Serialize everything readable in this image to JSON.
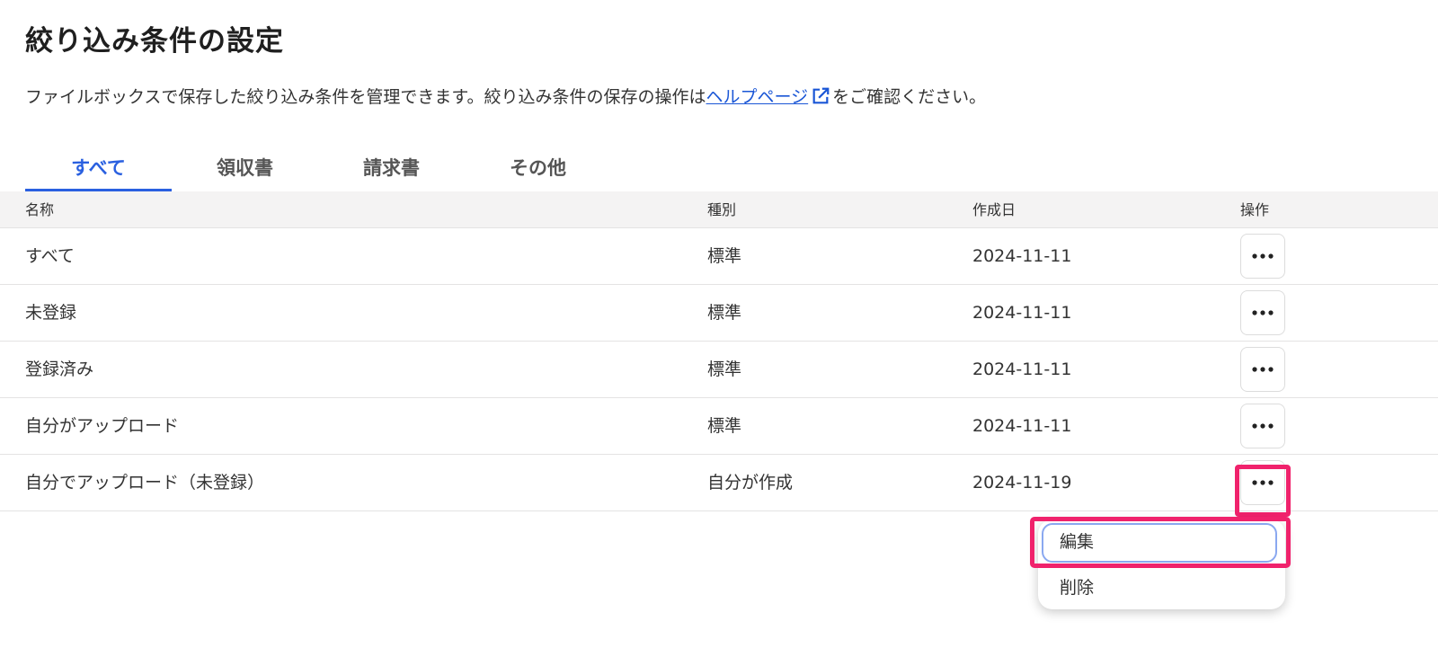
{
  "page": {
    "title": "絞り込み条件の設定",
    "description_before": "ファイルボックスで保存した絞り込み条件を管理できます。絞り込み条件の保存の操作は",
    "help_link": "ヘルプページ",
    "description_after": "をご確認ください。"
  },
  "tabs": [
    {
      "label": "すべて",
      "active": true
    },
    {
      "label": "領収書",
      "active": false
    },
    {
      "label": "請求書",
      "active": false
    },
    {
      "label": "その他",
      "active": false
    }
  ],
  "table": {
    "headers": {
      "name": "名称",
      "type": "種別",
      "created": "作成日",
      "actions": "操作"
    },
    "rows": [
      {
        "name": "すべて",
        "type": "標準",
        "created": "2024-11-11"
      },
      {
        "name": "未登録",
        "type": "標準",
        "created": "2024-11-11"
      },
      {
        "name": "登録済み",
        "type": "標準",
        "created": "2024-11-11"
      },
      {
        "name": "自分がアップロード",
        "type": "標準",
        "created": "2024-11-11"
      },
      {
        "name": "自分でアップロード（未登録）",
        "type": "自分が作成",
        "created": "2024-11-19"
      }
    ]
  },
  "menu": {
    "edit": "編集",
    "delete": "削除"
  },
  "icons": {
    "more": "more-horizontal-icon",
    "external": "external-link-icon"
  },
  "colors": {
    "accent": "#2a60e0",
    "link": "#1a56d6",
    "highlight": "#f0226c",
    "header_bg": "#f4f3f3"
  }
}
